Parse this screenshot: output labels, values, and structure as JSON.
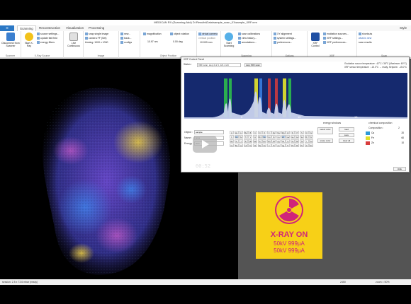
{
  "window": {
    "title": "MEDICAN RX (Scanning Add) D:\\Results\\Data\\sample_scan_01\\sample_XRF.xrm"
  },
  "menu": {
    "file_label": "☰",
    "tabs": [
      "Scanning",
      "Reconstruction",
      "Visualization",
      "Processing"
    ],
    "active_tab": "Scanning",
    "style_label": "Style"
  },
  "ribbon": {
    "groups": [
      "Scanner",
      "X-Ray Source",
      "",
      "Image",
      "Object Position",
      "",
      "Scanning",
      "Options",
      "XRF",
      "",
      "Scan"
    ],
    "buttons": {
      "disconnect": "Disconnect from Scanner",
      "start_xray": "Start X-Ray",
      "source_settings": "source settings...",
      "update_flat_field": "update flat field",
      "energy_filters": "energy filters",
      "live_continuous": "Live Continuous",
      "snap_single_image": "snap single image",
      "camera_ff": "camera FF (Set)",
      "binning": "binning: 1000 x 1000",
      "new": "new...",
      "track": "track...",
      "configs": "configs",
      "magnification": "magnification",
      "magnification_value": "10.97 nm",
      "object_rotation": "object rotation",
      "rotation_value": "0.00 deg",
      "virtual_camera": "virtual camera",
      "vertical_position": "vertical position",
      "vertical_value": "10.000 mm",
      "start_scanning": "Start Scanning",
      "scan_calibration": "scan calibrations",
      "view_history": "view history...",
      "annotations": "annotations...",
      "xrf_alignment": "XY alignment",
      "system_settings": "system settings...",
      "preferences": "preferences...",
      "xrf_control": "XRF Control",
      "excitation_sources": "excitation sources...",
      "xrf_settings": "XRF settings...",
      "xrf_preferences": "XRF preferences...",
      "shortcuts": "shortcuts",
      "what_is_new": "what is new",
      "scan_results": "scan results"
    }
  },
  "xrf_panel": {
    "title": "XRF Control Panel",
    "status_label": "Status :",
    "status_value": "XRF scan, step 4 of 4, 121 s left",
    "stop_button": "stop XRF scan",
    "excitation_temp": "Excitation source temperature : 42°C / 38°C (Maximum: 60°C)",
    "sensor_temp": "XRF sensor temperature : -15.0°C → ready, Setpoint : -15.0°C",
    "spectrum_ticks": [
      "5",
      "10",
      "15"
    ],
    "object_label": "Object :",
    "object_value": "sample",
    "name_label": "Name :",
    "name_value": "area",
    "energy_label": "Energy :",
    "energy_value": "auto",
    "energy_window_title": "energy windows",
    "select_color": "select color",
    "load": "load",
    "save": "save",
    "erase_color": "erase color",
    "clear_all": "clear all",
    "chem_title": "chemical composition",
    "composition_label": "Composition :",
    "composition_value": "2",
    "elements_comp": [
      {
        "name": "Ca",
        "value": "20",
        "color": "#2e9ad8"
      },
      {
        "name": "Fe",
        "value": "60",
        "color": "#e0e02a"
      },
      {
        "name": "Zn",
        "value": "10",
        "color": "#d83c3c"
      }
    ],
    "close_label": "Hide",
    "periodic_rows": [
      [
        "H",
        "He",
        "Li",
        "Be",
        "B",
        "C",
        "N",
        "O",
        "F",
        "Ne",
        "Na",
        "Mg",
        "Al",
        "Si",
        "P",
        "S",
        "Cl",
        "Ar"
      ],
      [
        "K",
        "Ca",
        "Sc",
        "Ti",
        "V",
        "Cr",
        "Mn",
        "Fe",
        "Co",
        "Ni",
        "Cu",
        "Zn",
        "Ga",
        "Ge",
        "As",
        "Se",
        "Br",
        "Kr"
      ],
      [
        "Rb",
        "Sr",
        "Y",
        "Zr",
        "Nb",
        "Mo",
        "Tc",
        "Ru",
        "Rh",
        "Pd",
        "Ag",
        "Cd",
        "In",
        "Sn",
        "Sb",
        "Te",
        "I",
        "Xe"
      ],
      [
        "Cs",
        "Ba",
        "La",
        "Hf",
        "Ta",
        "W",
        "Re",
        "Os",
        "Ir",
        "Pt",
        "Au",
        "Hg",
        "Tl",
        "Pb",
        "Bi",
        "Po",
        "At",
        "Rn"
      ]
    ],
    "selected_elements": [
      "Ca",
      "Fe",
      "Zn"
    ]
  },
  "video_overlay": {
    "timestamp": "00:52"
  },
  "xray_sign": {
    "line1": "X-RAY ON",
    "line2": "50kV 999µA",
    "line3": "50kV 999µA",
    "color": "#d0247a",
    "background": "#f7d017"
  },
  "statusbar": {
    "left": "session: 2.5 x 73.6 mbar (ready)",
    "zoom": "zoom = 50%",
    "value": "2450"
  },
  "colors": {
    "ribbon_accent": "#2b78c5",
    "spectrum_bg": "#15296e",
    "peak_green": "#2ec54a",
    "peak_yellow": "#e6e62a",
    "peak_blue": "#3a7de0",
    "peak_red": "#d83c3c"
  }
}
